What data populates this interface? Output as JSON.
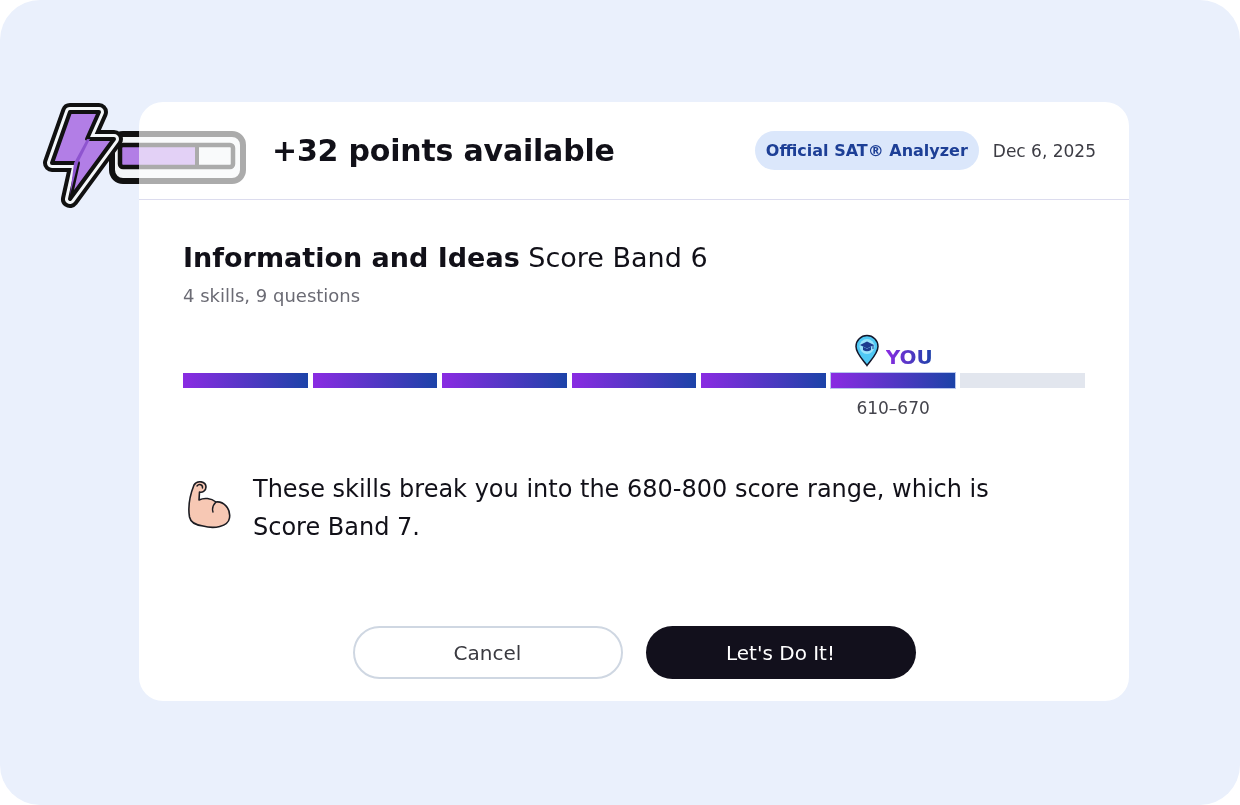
{
  "header": {
    "title": "+32 points available",
    "badge": "Official SAT® Analyzer",
    "date": "Dec 6, 2025"
  },
  "section": {
    "heading": "**Information and Ideas** Score Band 6",
    "summary": "4 skills, 9 questions"
  },
  "score_bar": {
    "segments": [
      {
        "filled": true,
        "selected": false
      },
      {
        "filled": true,
        "selected": false
      },
      {
        "filled": true,
        "selected": false
      },
      {
        "filled": true,
        "selected": false
      },
      {
        "filled": true,
        "selected": false
      },
      {
        "filled": true,
        "selected": true
      },
      {
        "filled": false,
        "selected": false
      }
    ],
    "marker_label": "YOU",
    "range": "610–670"
  },
  "message": "These skills break you into the 680-800 score range, which is Score Band 7.",
  "buttons": [
    {
      "label": "Cancel",
      "kind": "secondary"
    },
    {
      "label": "Let's Do It!",
      "kind": "primary"
    }
  ]
}
